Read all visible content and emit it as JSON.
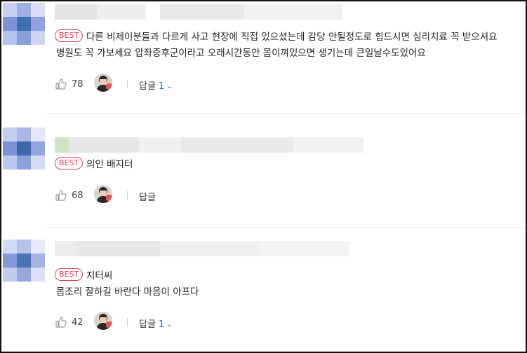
{
  "comments": [
    {
      "badge": "BEST",
      "lines": [
        "다른 비제이분들과 다르게 사고 현장에 직접 있으셨는데 감당 안될정도로 힘드시면 심리치료 꼭 받으셔요",
        "병원도 꼭 가보세요 압좌증후군이라고 오래시간동안 몸이껴있으면 생기는데 큰일날수도있어요"
      ],
      "likes": "78",
      "reply_label": "답글",
      "reply_count": "1"
    },
    {
      "badge": "BEST",
      "lines": [
        "의인 배지터"
      ],
      "likes": "68",
      "reply_label": "답글",
      "reply_count": ""
    },
    {
      "badge": "BEST",
      "lines": [
        "지터씨",
        "몸조리  잘하길 바란다 마음이 아프다"
      ],
      "likes": "42",
      "reply_label": "답글",
      "reply_count": "1"
    }
  ],
  "colors": {
    "badge": "#d6455b",
    "reply_count": "#2e6bd6"
  },
  "icons": {
    "like": "thumbs-up-icon",
    "expand": "chevron-down-icon"
  }
}
